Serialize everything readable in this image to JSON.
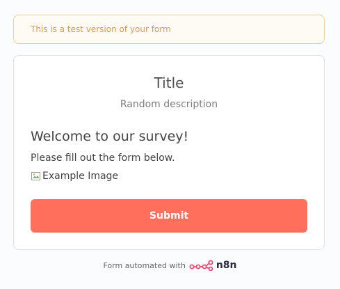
{
  "banner": {
    "text": "This is a test version of your form"
  },
  "form": {
    "title": "Title",
    "description": "Random description",
    "welcome_heading": "Welcome to our survey!",
    "instructions": "Please fill out the form below.",
    "image_alt": "Example Image",
    "submit_label": "Submit"
  },
  "footer": {
    "text": "Form automated with",
    "brand_name": "n8n",
    "brand_icon": "n8n-logo-icon"
  },
  "colors": {
    "accent": "#ff6f5c",
    "banner_border": "#f3cf97",
    "banner_text": "#dc9a4e",
    "brand_logo": "#ea4b71"
  }
}
